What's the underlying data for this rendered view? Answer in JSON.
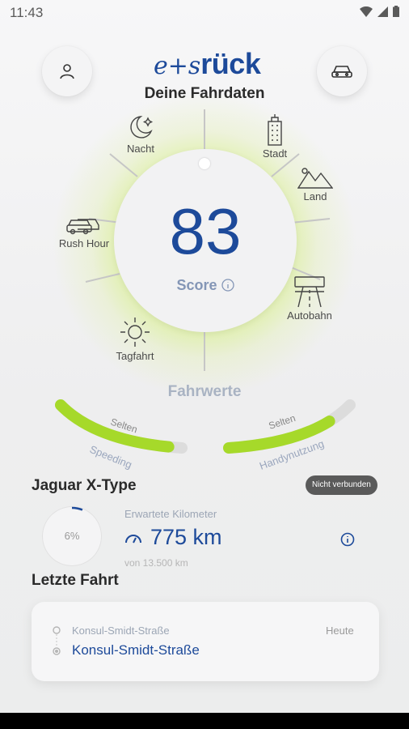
{
  "status_bar": {
    "time": "11:43"
  },
  "header": {
    "logo_prefix": "e+s",
    "logo_brand": "rück",
    "title": "Deine Fahrdaten",
    "profile_icon": "person-icon",
    "vehicle_icon": "car-icon"
  },
  "score": {
    "value": "83",
    "label": "Score",
    "info_icon": "info-icon"
  },
  "categories": [
    {
      "label": "Nacht",
      "icon": "moon-stars-icon"
    },
    {
      "label": "Stadt",
      "icon": "city-building-icon"
    },
    {
      "label": "Land",
      "icon": "mountains-icon"
    },
    {
      "label": "Rush Hour",
      "icon": "cars-traffic-icon"
    },
    {
      "label": "Autobahn",
      "icon": "highway-icon"
    },
    {
      "label": "Tagfahrt",
      "icon": "sun-icon"
    }
  ],
  "fahrwerte": {
    "title": "Fahrwerte",
    "gauges": [
      {
        "label": "Speeding",
        "level_text": "Selten",
        "fill": 0.9
      },
      {
        "label": "Handynutzung",
        "level_text": "Selten",
        "fill": 0.8
      }
    ]
  },
  "vehicle": {
    "name": "Jaguar X-Type",
    "connection_badge": "Nicht verbunden",
    "progress_percent": "6%",
    "progress_value": 0.06,
    "km_caption": "Erwartete Kilometer",
    "km_value": "775 km",
    "km_sub": "von 13.500 km"
  },
  "last_trip": {
    "title": "Letzte Fahrt",
    "start": "Konsul-Smidt-Straße",
    "end": "Konsul-Smidt-Straße",
    "date": "Heute"
  },
  "colors": {
    "brand_blue": "#1d4a9a",
    "accent_green": "#a6d92a"
  }
}
